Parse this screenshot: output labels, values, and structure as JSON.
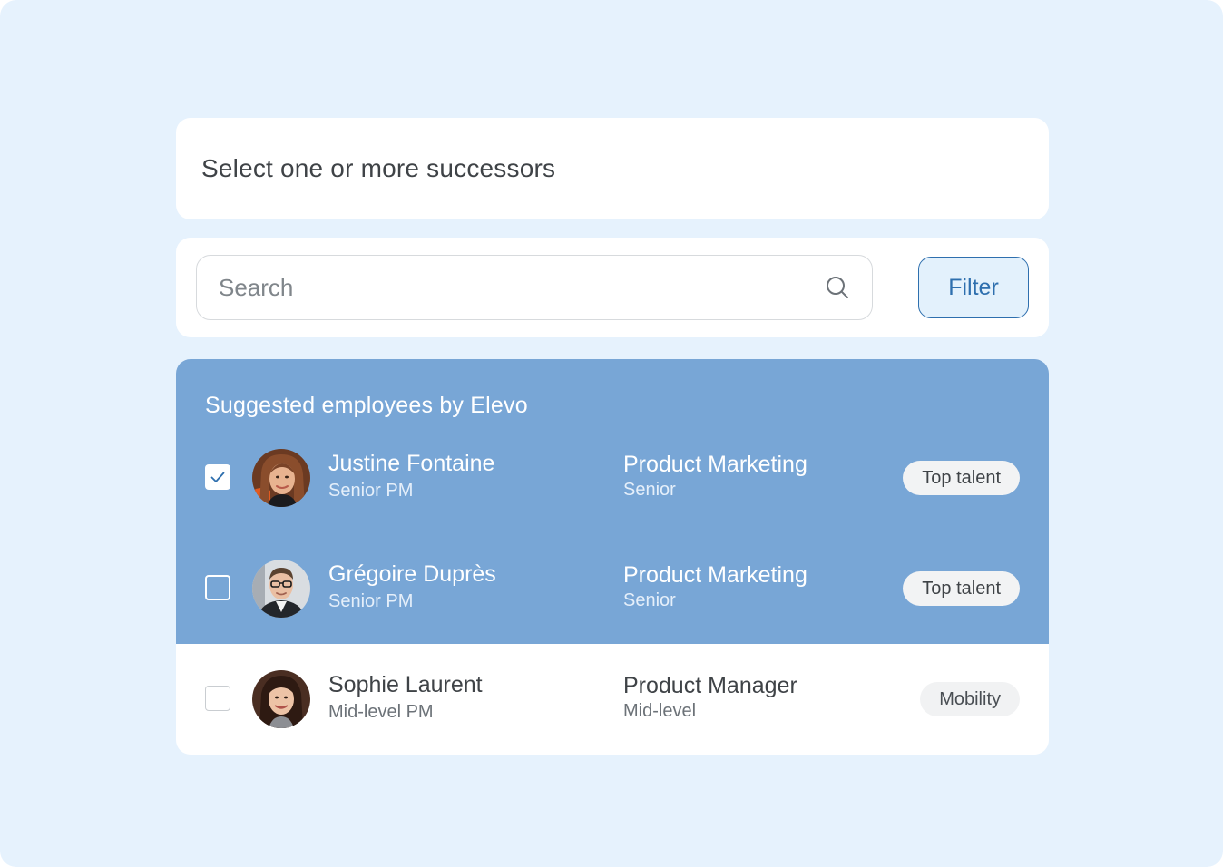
{
  "header": {
    "title": "Select one or more successors"
  },
  "search": {
    "placeholder": "Search",
    "icon": "search-icon",
    "filter_label": "Filter"
  },
  "suggested": {
    "title": "Suggested employees by Elevo",
    "background_color": "#78a6d6",
    "employees": [
      {
        "name": "Justine Fontaine",
        "role": "Senior PM",
        "department": "Product Marketing",
        "level": "Senior",
        "badge": "Top talent",
        "checked": true
      },
      {
        "name": "Grégoire Duprès",
        "role": "Senior PM",
        "department": "Product Marketing",
        "level": "Senior",
        "badge": "Top talent",
        "checked": false
      }
    ]
  },
  "others": {
    "employees": [
      {
        "name": "Sophie Laurent",
        "role": "Mid-level PM",
        "department": "Product Manager",
        "level": "Mid-level",
        "badge": "Mobility",
        "checked": false
      }
    ]
  },
  "colors": {
    "page_background": "#e6f2fd",
    "accent": "#2e6fae",
    "card_background": "#ffffff"
  }
}
